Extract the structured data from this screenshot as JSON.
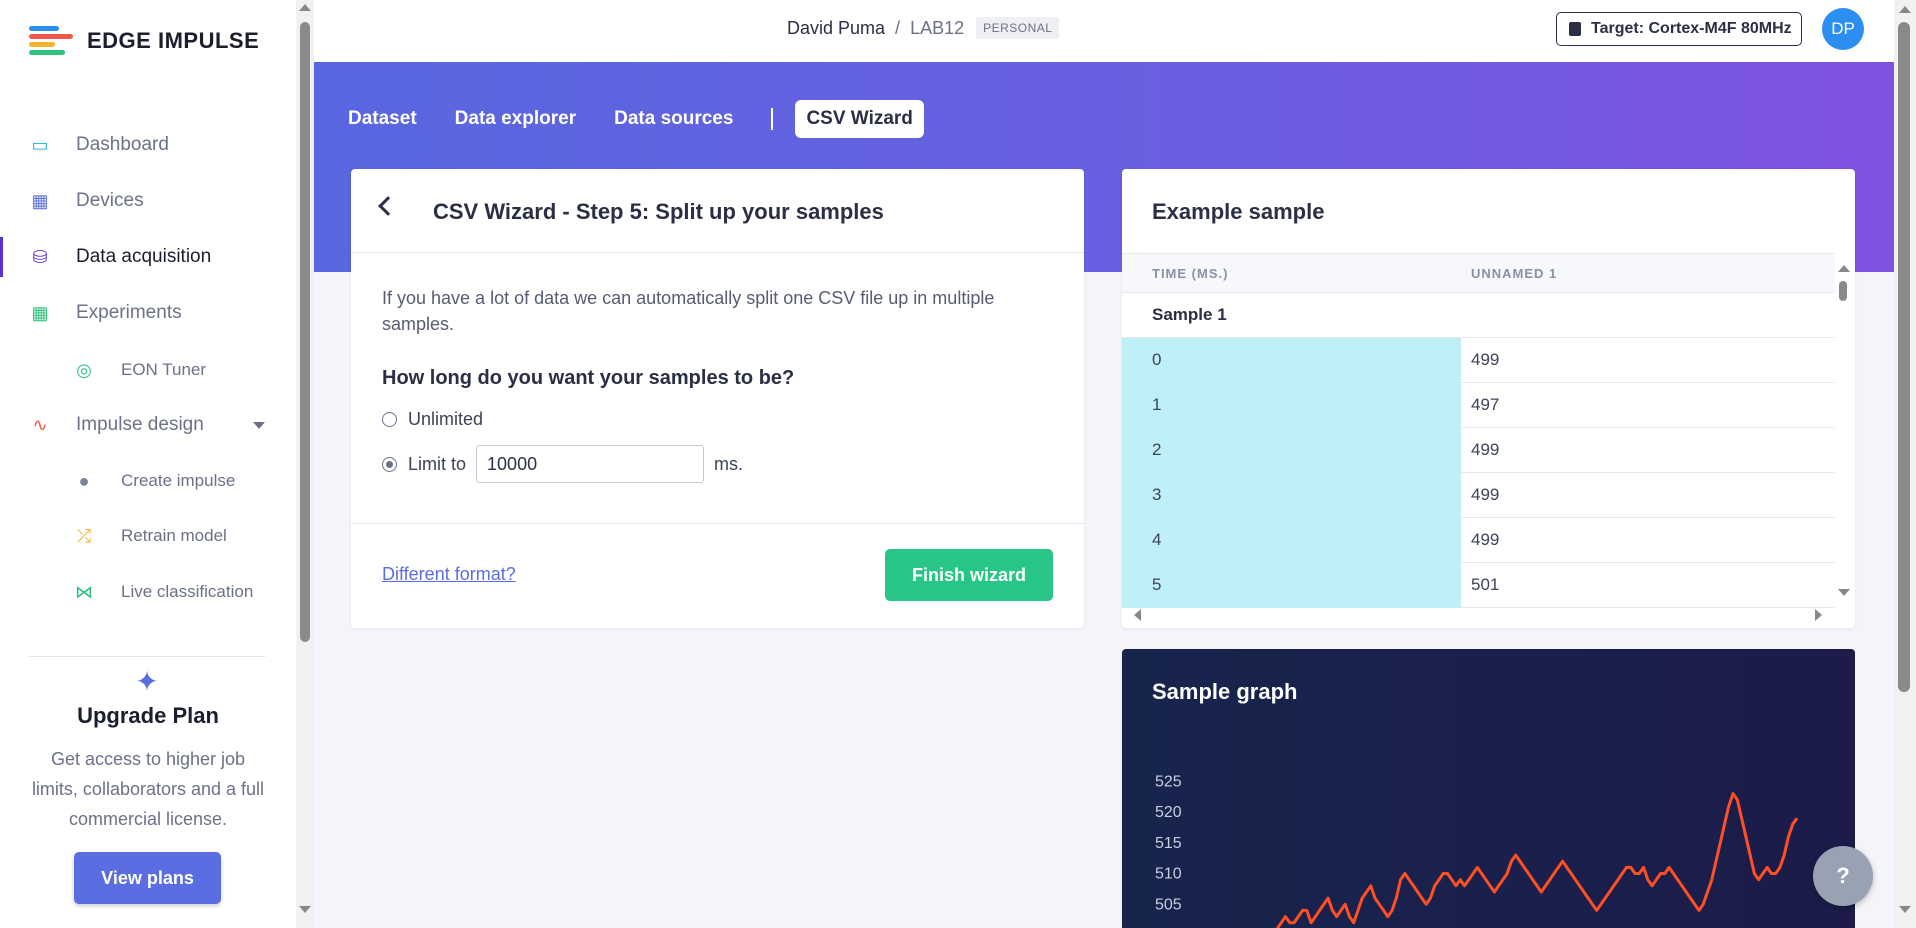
{
  "brand": {
    "name": "EDGE IMPULSE",
    "colors": [
      "#f15a4a",
      "#f7b32b",
      "#2fc27c",
      "#2b8ef0",
      "#5b2fd6"
    ]
  },
  "sidebar": {
    "items": [
      {
        "label": "Dashboard",
        "icon": "monitor-icon",
        "color": "#2bb7e4"
      },
      {
        "label": "Devices",
        "icon": "chip-icon",
        "color": "#5b6ee1"
      },
      {
        "label": "Data acquisition",
        "icon": "database-icon",
        "color": "#5b2fd6",
        "active": true
      },
      {
        "label": "Experiments",
        "icon": "table-icon",
        "color": "#2fc27c"
      },
      {
        "label": "EON Tuner",
        "icon": "compass-icon",
        "color": "#2fc27c",
        "sub": true
      },
      {
        "label": "Impulse design",
        "icon": "pulse-icon",
        "color": "#f15a4a",
        "expandable": true
      },
      {
        "label": "Create impulse",
        "icon": "dot-icon",
        "color": "#7a8399",
        "sub": true
      },
      {
        "label": "Retrain model",
        "icon": "shuffle-icon",
        "color": "#f7b32b",
        "sub": true
      },
      {
        "label": "Live classification",
        "icon": "network-icon",
        "color": "#2fc27c",
        "sub": true
      }
    ],
    "upgrade": {
      "title": "Upgrade Plan",
      "text": "Get access to higher job limits, collaborators and a full commercial license.",
      "button": "View plans"
    }
  },
  "header": {
    "user": "David Puma",
    "separator": "/",
    "project": "LAB12",
    "badge": "PERSONAL",
    "target": "Target: Cortex-M4F 80MHz",
    "avatar": "DP"
  },
  "tabs": [
    {
      "label": "Dataset"
    },
    {
      "label": "Data explorer"
    },
    {
      "label": "Data sources"
    },
    {
      "label": "CSV Wizard",
      "active": true
    }
  ],
  "wizard": {
    "title": "CSV Wizard - Step 5: Split up your samples",
    "description": "If you have a lot of data we can automatically split one CSV file up in multiple samples.",
    "question": "How long do you want your samples to be?",
    "option_unlimited": "Unlimited",
    "option_limit": "Limit to",
    "limit_value": "10000",
    "unit": "ms.",
    "different_format": "Different format?",
    "finish": "Finish wizard"
  },
  "sample": {
    "title": "Example sample",
    "columns": [
      "TIME (MS.)",
      "UNNAMED 1"
    ],
    "group": "Sample 1",
    "rows": [
      [
        "0",
        "499"
      ],
      [
        "1",
        "497"
      ],
      [
        "2",
        "499"
      ],
      [
        "3",
        "499"
      ],
      [
        "4",
        "499"
      ],
      [
        "5",
        "501"
      ]
    ]
  },
  "graph": {
    "title": "Sample graph",
    "chart_data": {
      "type": "line",
      "y_ticks": [
        "525",
        "520",
        "515",
        "510",
        "505"
      ],
      "ylim": [
        500,
        527
      ],
      "series": [
        {
          "values": [
            501,
            502,
            503,
            502,
            502,
            503,
            504,
            504,
            502,
            503,
            504,
            505,
            506,
            504,
            503,
            504,
            505,
            503,
            502,
            504,
            506,
            507,
            508,
            506,
            505,
            504,
            503,
            504,
            506,
            509,
            510,
            509,
            508,
            507,
            506,
            505,
            506,
            508,
            509,
            510,
            510,
            509,
            508,
            509,
            508,
            509,
            510,
            511,
            510,
            509,
            508,
            507,
            508,
            509,
            510,
            512,
            513,
            512,
            511,
            510,
            509,
            508,
            507,
            508,
            509,
            510,
            511,
            512,
            511,
            510,
            509,
            508,
            507,
            506,
            505,
            504,
            505,
            506,
            507,
            508,
            509,
            510,
            511,
            511,
            510,
            510,
            511,
            509,
            508,
            509,
            510,
            510,
            511,
            510,
            509,
            508,
            507,
            506,
            505,
            504,
            505,
            507,
            509,
            512,
            515,
            518,
            521,
            523,
            522,
            519,
            516,
            513,
            510,
            509,
            510,
            511,
            510,
            510,
            511,
            513,
            516,
            518,
            519
          ]
        }
      ],
      "color": "#ff4f23"
    }
  },
  "help": "?"
}
